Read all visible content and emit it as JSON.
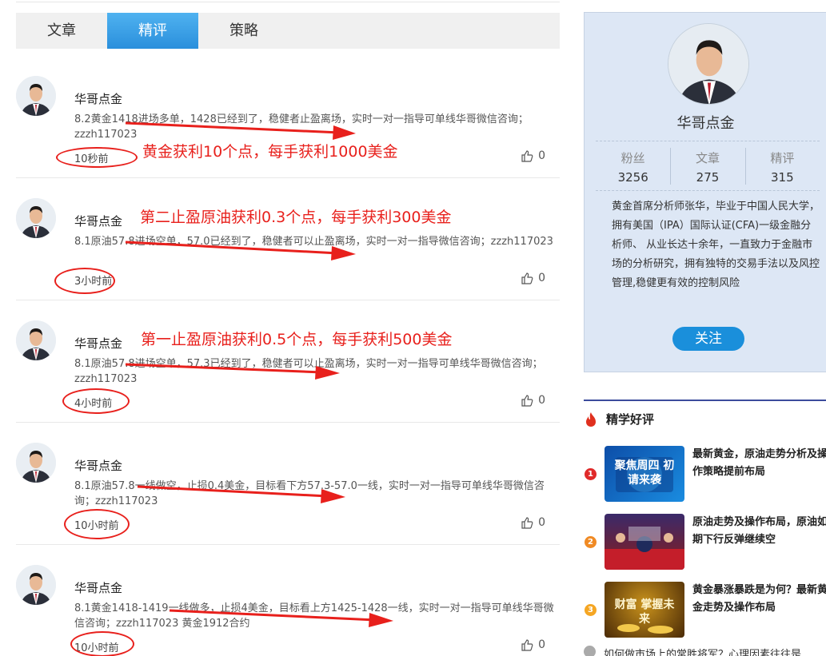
{
  "tabs": [
    "文章",
    "精评",
    "策略"
  ],
  "active_tab": "精评",
  "posts": [
    {
      "author": "华哥点金",
      "text": "8.2黄金1418进场多单，1428已经到了，稳健者止盈离场，实时一对一指导可单线华哥微信咨询；zzzh117023",
      "time": "10秒前",
      "likes": "0",
      "annotation": "黄金获利10个点，每手获利1000美金"
    },
    {
      "author": "华哥点金",
      "text": "8.1原油57.8进场空单，57.0已经到了，稳健者可以止盈离场，实时一对一指导微信咨询；zzzh117023",
      "time": "3小时前",
      "likes": "0",
      "annotation": "第二止盈原油获利0.3个点，每手获利300美金"
    },
    {
      "author": "华哥点金",
      "text": "8.1原油57.8进场空单，57.3已经到了，稳健者可以止盈离场，实时一对一指导可单线华哥微信咨询；zzzh117023",
      "time": "4小时前",
      "likes": "0",
      "annotation": "第一止盈原油获利0.5个点，每手获利500美金"
    },
    {
      "author": "华哥点金",
      "text": "8.1原油57.8一线做空，止损0.4美金，目标看下方57.3-57.0一线，实时一对一指导可单线华哥微信咨询；zzzh117023",
      "time": "10小时前",
      "likes": "0",
      "annotation": ""
    },
    {
      "author": "华哥点金",
      "text": "8.1黄金1418-1419一线做多，止损4美金，目标看上方1425-1428一线，实时一对一指导可单线华哥微信咨询；zzzh117023 黄金1912合约",
      "time": "10小时前",
      "likes": "0",
      "annotation": ""
    }
  ],
  "profile": {
    "name": "华哥点金",
    "stats": [
      {
        "label": "粉丝",
        "value": "3256"
      },
      {
        "label": "文章",
        "value": "275"
      },
      {
        "label": "精评",
        "value": "315"
      }
    ],
    "bio": "黄金首席分析师张华，毕业于中国人民大学，拥有美国（IPA）国际认证(CFA)一级金融分析师、 从业长达十余年，一直致力于金融市场的分析研究，拥有独特的交易手法以及风控管理,稳健更有效的控制风险",
    "follow_label": "关注"
  },
  "hot": {
    "title": "精学好评",
    "items": [
      {
        "rank": "1",
        "text": "最新黄金，原油走势分析及操作策略提前布局",
        "thumb_text": "聚焦周四 初请来袭",
        "color": "#e02a2a"
      },
      {
        "rank": "2",
        "text": "原油走势及操作布局，原油如期下行反弹继续空",
        "thumb_text": "",
        "color": "#f08a24"
      },
      {
        "rank": "3",
        "text": "黄金暴涨暴跌是为何？最新黄金走势及操作布局",
        "thumb_text": "财富 掌握未来",
        "color": "#f5a623"
      }
    ],
    "cut_text": "如何做市场上的常胜将军？心理因素往往是"
  },
  "colors": {
    "accent": "#2a8fdc",
    "annotation_red": "#e8201c",
    "panel_bg": "#dde7f5"
  }
}
